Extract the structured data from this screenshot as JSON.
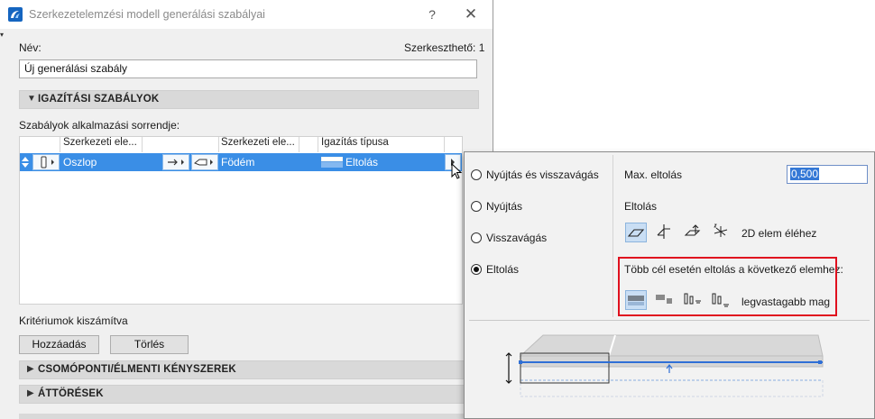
{
  "window": {
    "title": "Szerkezetelemzési modell generálási szabályai",
    "help_glyph": "?",
    "close_glyph": "✕"
  },
  "form": {
    "name_label": "Név:",
    "editable_label": "Szerkeszthető: 1",
    "name_value": "Új generálási szabály"
  },
  "sections": {
    "alignment": "IGAZÍTÁSI SZABÁLYOK",
    "nodal": "CSOMÓPONTI/ÉLMENTI KÉNYSZEREK",
    "openings": "ÁTTÖRÉSEK"
  },
  "rules": {
    "order_label": "Szabályok alkalmazási sorrendje:",
    "headers": {
      "element_a": "Szerkezeti ele...",
      "element_b": "Szerkezeti ele...",
      "alignment_type": "Igazítás típusa"
    },
    "rows": [
      {
        "element_a": "Oszlop",
        "element_b": "Födém",
        "alignment_type": "Eltolás"
      }
    ]
  },
  "footer": {
    "criteria_label": "Kritériumok kiszámítva",
    "add_button": "Hozzáadás",
    "delete_button": "Törlés"
  },
  "popup": {
    "options": [
      {
        "label": "Nyújtás és visszavágás",
        "selected": false
      },
      {
        "label": "Nyújtás",
        "selected": false
      },
      {
        "label": "Visszavágás",
        "selected": false
      },
      {
        "label": "Eltolás",
        "selected": true
      }
    ],
    "max_offset_label": "Max. eltolás",
    "max_offset_value": "0,500",
    "offset_label": "Eltolás",
    "edge_label": "2D elem éléhez",
    "multi_target_label": "Több cél esetén eltolás a következő elemhez:",
    "thickest_label": "legvastagabb mag"
  },
  "colors": {
    "selection": "#3a8ee6",
    "highlight": "#e0101e",
    "section_bar": "#d9d9d9"
  }
}
